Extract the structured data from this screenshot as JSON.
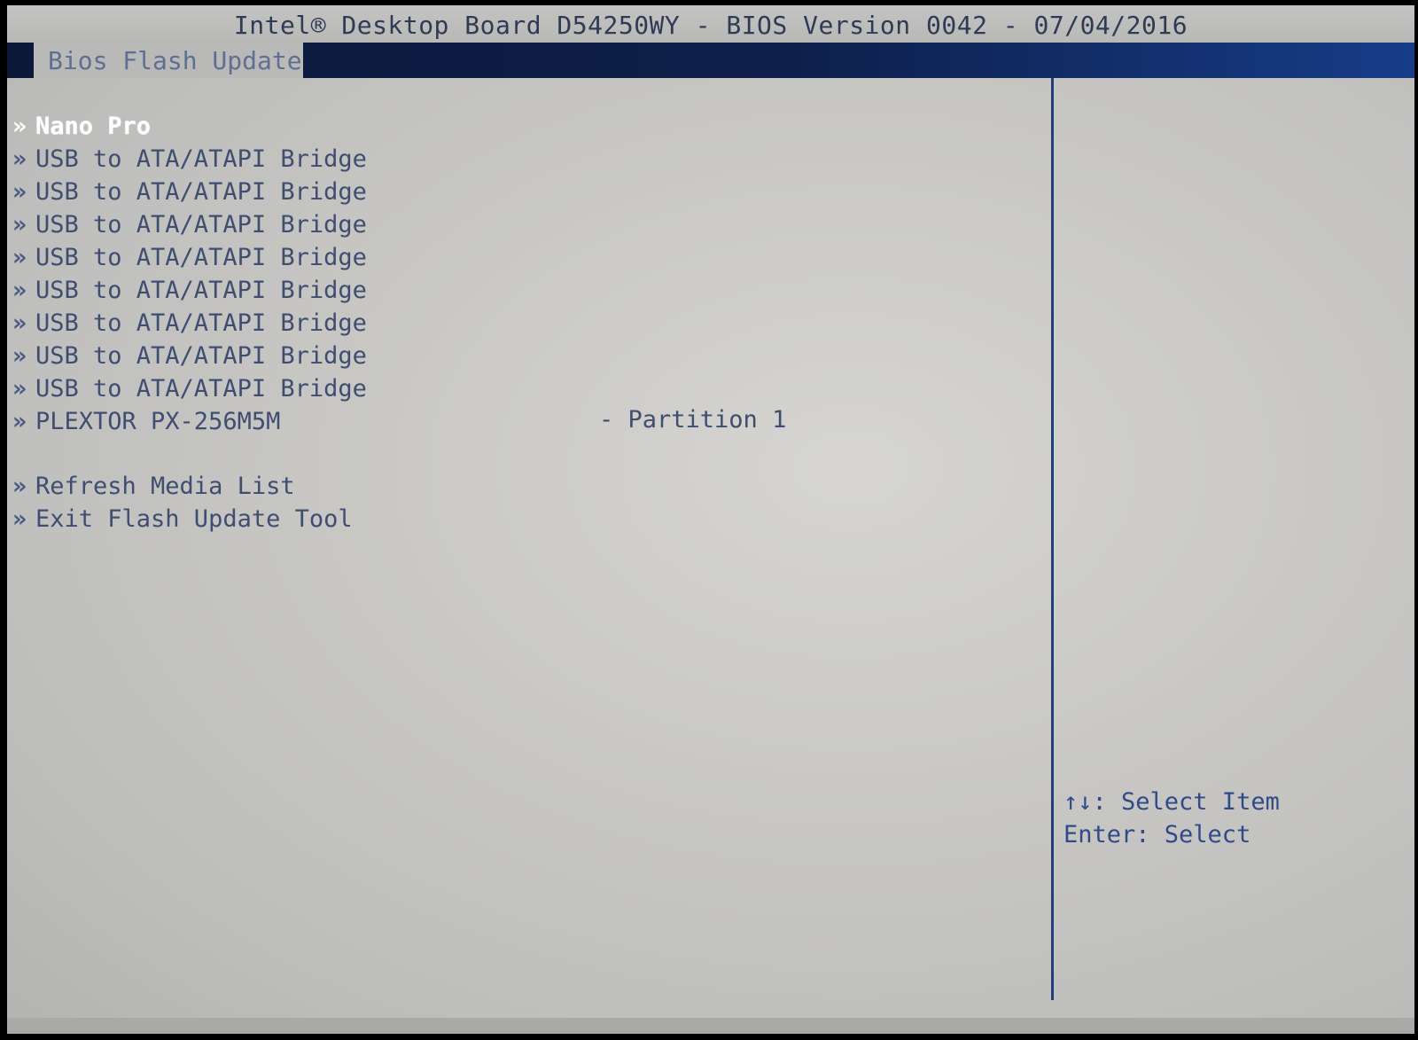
{
  "header": {
    "title": "Intel® Desktop Board D54250WY - BIOS Version 0042 - 07/04/2016",
    "tab_label": "Bios Flash Update"
  },
  "menu": {
    "items": [
      {
        "label": "Nano Pro",
        "selected": true
      },
      {
        "label": "USB to ATA/ATAPI Bridge"
      },
      {
        "label": "USB to ATA/ATAPI Bridge"
      },
      {
        "label": "USB to ATA/ATAPI Bridge"
      },
      {
        "label": "USB to ATA/ATAPI Bridge"
      },
      {
        "label": "USB to ATA/ATAPI Bridge"
      },
      {
        "label": "USB to ATA/ATAPI Bridge"
      },
      {
        "label": "USB to ATA/ATAPI Bridge"
      },
      {
        "label": "USB to ATA/ATAPI Bridge"
      },
      {
        "label": "PLEXTOR PX-256M5M",
        "detail": "- Partition 1"
      }
    ],
    "actions": [
      {
        "label": "Refresh Media List"
      },
      {
        "label": "Exit Flash Update Tool"
      }
    ],
    "chevron": "»"
  },
  "help": {
    "select_item": "↑↓: Select Item",
    "enter_select": "Enter: Select"
  },
  "colors": {
    "tab_bar": "#0d1f4a",
    "divider": "#1f3f7f",
    "text": "#3e4d70",
    "selected_text": "#ffffff"
  }
}
